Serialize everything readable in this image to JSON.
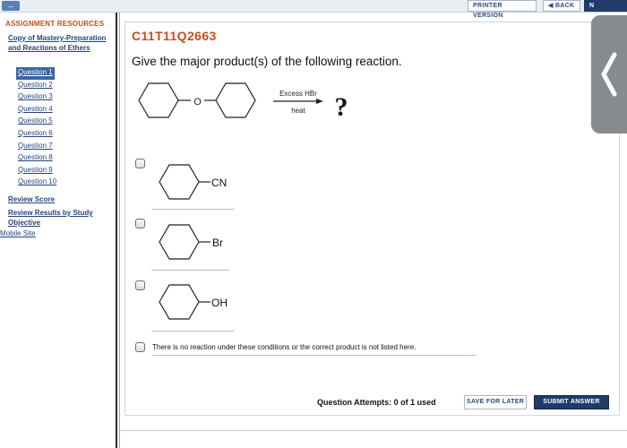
{
  "topbar": {
    "printer_label": "PRINTER VERSION",
    "back_label": "BACK",
    "next_label": "N"
  },
  "sidebar": {
    "title": "ASSIGNMENT RESOURCES",
    "assignment_link": "Copy of Mastery-Preparation and Reactions of Ethers",
    "questions": [
      "Question 1",
      "Question 2",
      "Question 3",
      "Question 4",
      "Question 5",
      "Question 6",
      "Question 7",
      "Question 8",
      "Question 9",
      "Question 10"
    ],
    "active_question": 0,
    "review_score": "Review Score",
    "review_results": "Review Results by Study Objective",
    "mobile_site": "Mobile Site"
  },
  "question": {
    "id": "C11T11Q2663",
    "prompt": "Give the major product(s) of the following reaction.",
    "reagent": "Excess HBr",
    "condition": "heat",
    "unknown": "?",
    "ether_atom": "O"
  },
  "options": [
    {
      "substituent": "CN",
      "checked": false
    },
    {
      "substituent": "Br",
      "checked": false
    },
    {
      "substituent": "OH",
      "checked": false
    },
    {
      "text": "There is no reaction under these conditions or the correct product is not listed here.",
      "checked": false
    }
  ],
  "footer": {
    "attempts_text": "Question Attempts: 0 of 1 used",
    "save_label": "SAVE FOR LATER",
    "submit_label": "SUBMIT ANSWER"
  },
  "colors": {
    "accent_orange": "#c44d1d",
    "link_blue": "#23457a",
    "nav_dark": "#203b6a"
  }
}
